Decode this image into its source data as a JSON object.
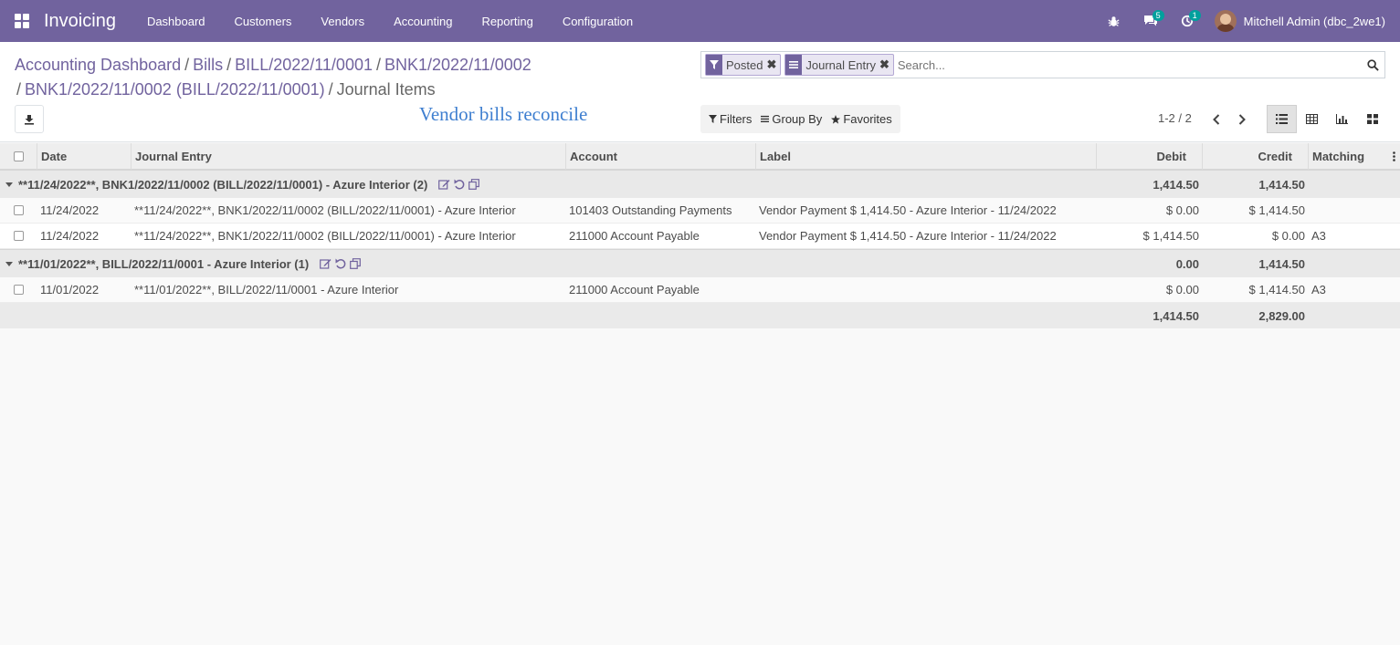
{
  "topbar": {
    "app_name": "Invoicing",
    "menu": [
      "Dashboard",
      "Customers",
      "Vendors",
      "Accounting",
      "Reporting",
      "Configuration"
    ],
    "chat_badge": "5",
    "activity_badge": "1",
    "user": "Mitchell Admin (dbc_2we1)",
    "accent": "#71639e"
  },
  "breadcrumb": {
    "items": [
      "Accounting Dashboard",
      "Bills",
      "BILL/2022/11/0001",
      "BNK1/2022/11/0002",
      "BNK1/2022/11/0002 (BILL/2022/11/0001)"
    ],
    "current": "Journal Items"
  },
  "title_text": "Vendor bills reconcile",
  "search": {
    "facets": [
      {
        "label": "Posted",
        "icon": "filter-icon"
      },
      {
        "label": "Journal Entry",
        "icon": "group-by-icon"
      }
    ],
    "placeholder": "Search..."
  },
  "filters": {
    "filters_label": "Filters",
    "group_by_label": "Group By",
    "favorites_label": "Favorites"
  },
  "pager": {
    "value": "1-2 / 2"
  },
  "table": {
    "headers": {
      "date": "Date",
      "journal_entry": "Journal Entry",
      "account": "Account",
      "label": "Label",
      "debit": "Debit",
      "credit": "Credit",
      "matching": "Matching"
    },
    "groups": [
      {
        "title": "**11/24/2022**, BNK1/2022/11/0002 (BILL/2022/11/0001) - Azure Interior (2)",
        "debit": "1,414.50",
        "credit": "1,414.50",
        "rows": [
          {
            "date": "11/24/2022",
            "entry": "**11/24/2022**, BNK1/2022/11/0002 (BILL/2022/11/0001) - Azure Interior",
            "account": "101403 Outstanding Payments",
            "label": "Vendor Payment $ 1,414.50 - Azure Interior - 11/24/2022",
            "debit": "$ 0.00",
            "credit": "$ 1,414.50",
            "matching": ""
          },
          {
            "date": "11/24/2022",
            "entry": "**11/24/2022**, BNK1/2022/11/0002 (BILL/2022/11/0001) - Azure Interior",
            "account": "211000 Account Payable",
            "label": "Vendor Payment $ 1,414.50 - Azure Interior - 11/24/2022",
            "debit": "$ 1,414.50",
            "credit": "$ 0.00",
            "matching": "A3"
          }
        ]
      },
      {
        "title": "**11/01/2022**, BILL/2022/11/0001 - Azure Interior (1)",
        "debit": "0.00",
        "credit": "1,414.50",
        "rows": [
          {
            "date": "11/01/2022",
            "entry": "**11/01/2022**, BILL/2022/11/0001 - Azure Interior",
            "account": "211000 Account Payable",
            "label": "",
            "debit": "$ 0.00",
            "credit": "$ 1,414.50",
            "matching": "A3"
          }
        ]
      }
    ],
    "totals": {
      "debit": "1,414.50",
      "credit": "2,829.00"
    }
  }
}
